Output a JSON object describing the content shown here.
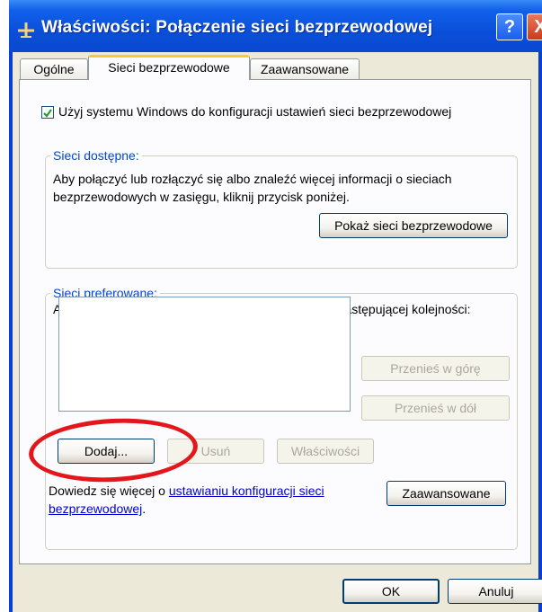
{
  "window": {
    "title": "Właściwości: Połączenie sieci bezprzewodowej",
    "help_glyph": "?",
    "close_glyph": "X"
  },
  "tabs": [
    {
      "label": "Ogólne",
      "active": false
    },
    {
      "label": "Sieci bezprzewodowe",
      "active": true
    },
    {
      "label": "Zaawansowane",
      "active": false
    }
  ],
  "main": {
    "use_windows_checkbox": {
      "label": "Użyj systemu Windows do konfiguracji ustawień sieci bezprzewodowej",
      "checked": true
    },
    "available": {
      "title": "Sieci dostępne:",
      "description": "Aby połączyć lub rozłączyć się albo znaleźć więcej informacji o sieciach bezprzewodowych w zasięgu, kliknij przycisk poniżej.",
      "show_button": "Pokaż sieci bezprzewodowe"
    },
    "preferred": {
      "title": "Sieci preferowane:",
      "description": "Automatycznie połącz się z dostępnymi sieciami w następującej kolejności:",
      "move_up": "Przenieś w górę",
      "move_down": "Przenieś w dół",
      "add": "Dodaj...",
      "remove": "Usuń",
      "properties": "Właściwości",
      "learn_prefix": "Dowiedz się więcej o ",
      "learn_link": "ustawianiu konfiguracji sieci bezprzewodowej",
      "learn_suffix": ".",
      "advanced": "Zaawansowane"
    }
  },
  "footer": {
    "ok": "OK",
    "cancel": "Anuluj"
  },
  "colors": {
    "titlebar": "#0a48cf",
    "dialog_bg": "#ece9d8",
    "accent_blue": "#0046d5",
    "highlight_red": "#e3161b"
  }
}
